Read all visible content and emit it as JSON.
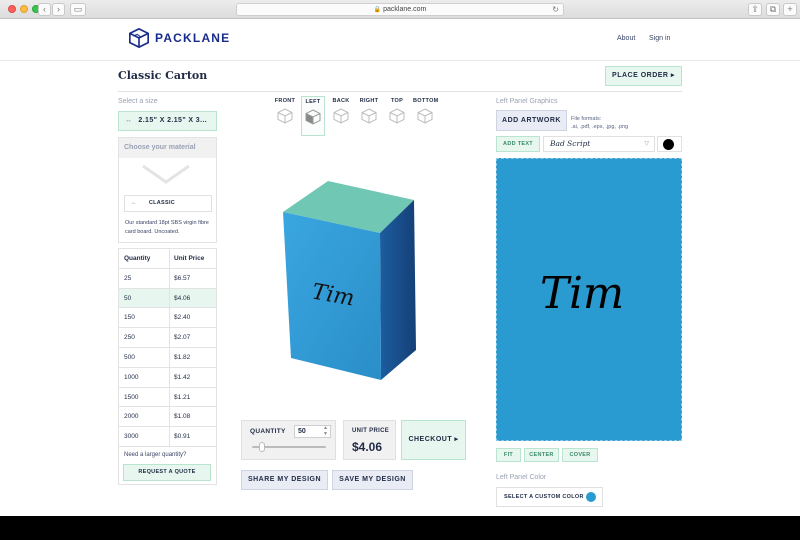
{
  "browser": {
    "url": "packlane.com",
    "colors": {
      "close": "#fc605c",
      "minimize": "#fdbc40",
      "zoom": "#34c84a"
    }
  },
  "header": {
    "brand": "PACKLANE",
    "nav": {
      "about": "About",
      "signin": "Sign in"
    }
  },
  "product": {
    "title": "Classic Carton",
    "place_order": "PLACE ORDER ▸"
  },
  "size": {
    "label": "Select a size",
    "value": "2.15\" X 2.15\" X 3...",
    "icon": "resize-arrows-icon"
  },
  "material": {
    "header": "Choose your material",
    "option": "CLASSIC",
    "description": "Our standard 18pt SBS virgin fibre card board. Uncoated."
  },
  "pricing": {
    "headers": [
      "Quantity",
      "Unit Price"
    ],
    "rows": [
      {
        "qty": "25",
        "price": "$6.57"
      },
      {
        "qty": "50",
        "price": "$4.06",
        "selected": true
      },
      {
        "qty": "150",
        "price": "$2.40"
      },
      {
        "qty": "250",
        "price": "$2.07"
      },
      {
        "qty": "500",
        "price": "$1.82"
      },
      {
        "qty": "1000",
        "price": "$1.42"
      },
      {
        "qty": "1500",
        "price": "$1.21"
      },
      {
        "qty": "2000",
        "price": "$1.08"
      },
      {
        "qty": "3000",
        "price": "$0.91"
      }
    ],
    "larger_question": "Need a larger quantity?",
    "request_quote": "REQUEST A QUOTE"
  },
  "views": [
    {
      "label": "FRONT",
      "active": false
    },
    {
      "label": "LEFT",
      "active": true
    },
    {
      "label": "BACK",
      "active": false
    },
    {
      "label": "RIGHT",
      "active": false
    },
    {
      "label": "TOP",
      "active": false
    },
    {
      "label": "BOTTOM",
      "active": false
    }
  ],
  "preview": {
    "text": "Tim",
    "colors": {
      "front": "#2e96d2",
      "side": "#1a4f8a",
      "top": "#6fc7b4"
    }
  },
  "order": {
    "quantity_label": "QUANTITY",
    "quantity_value": "50",
    "unit_price_label": "UNIT PRICE",
    "unit_price_value": "$4.06",
    "checkout": "CHECKOUT ▸",
    "share": "SHARE MY DESIGN",
    "save": "SAVE MY DESIGN"
  },
  "right_panel": {
    "graphics_label": "Left Panel Graphics",
    "add_artwork": "ADD ARTWORK",
    "formats_label": "File formats:",
    "formats": ".ai, .pdf, .eps, .jpg, .png",
    "add_text": "ADD TEXT",
    "font": "Bad Script",
    "text_color": "#000000",
    "panel_color": "#2a9bd0",
    "canvas_text": "Tim",
    "fit": "FIT",
    "center": "CENTER",
    "cover": "COVER",
    "color_label": "Left Panel Color",
    "custom_color": "SELECT A CUSTOM COLOR"
  }
}
